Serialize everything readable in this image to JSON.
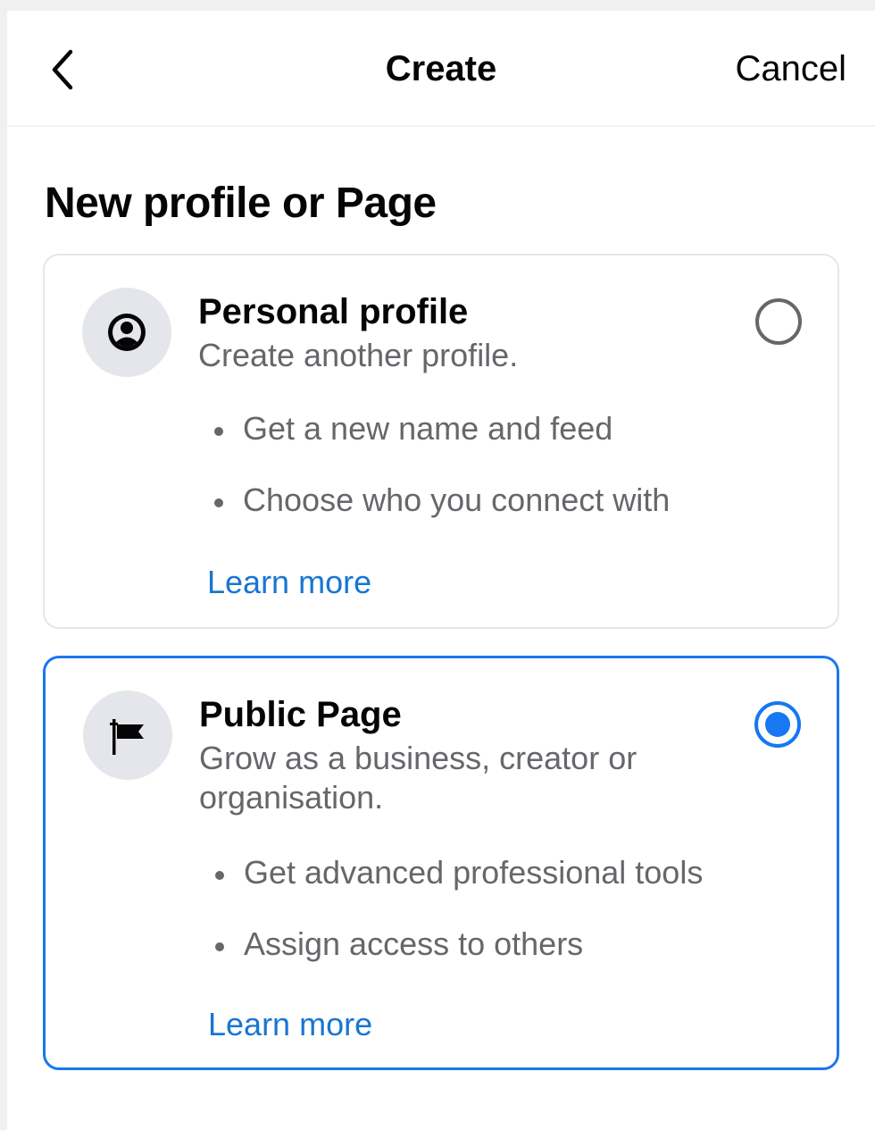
{
  "header": {
    "title": "Create",
    "cancel_label": "Cancel"
  },
  "section": {
    "title": "New profile or Page"
  },
  "options": [
    {
      "title": "Personal profile",
      "subtitle": "Create another profile.",
      "bullets": [
        "Get a new name and feed",
        "Choose who you connect with"
      ],
      "link": "Learn more",
      "icon": "person-circle-icon",
      "selected": false
    },
    {
      "title": "Public Page",
      "subtitle": "Grow as a business, creator or organisation.",
      "bullets": [
        "Get advanced professional tools",
        "Assign access to others"
      ],
      "link": "Learn more",
      "icon": "flag-icon",
      "selected": true
    }
  ],
  "colors": {
    "accent": "#1877f2",
    "secondary_text": "#65676b",
    "card_border": "#e4e6e8",
    "icon_background": "#e4e6eb"
  }
}
